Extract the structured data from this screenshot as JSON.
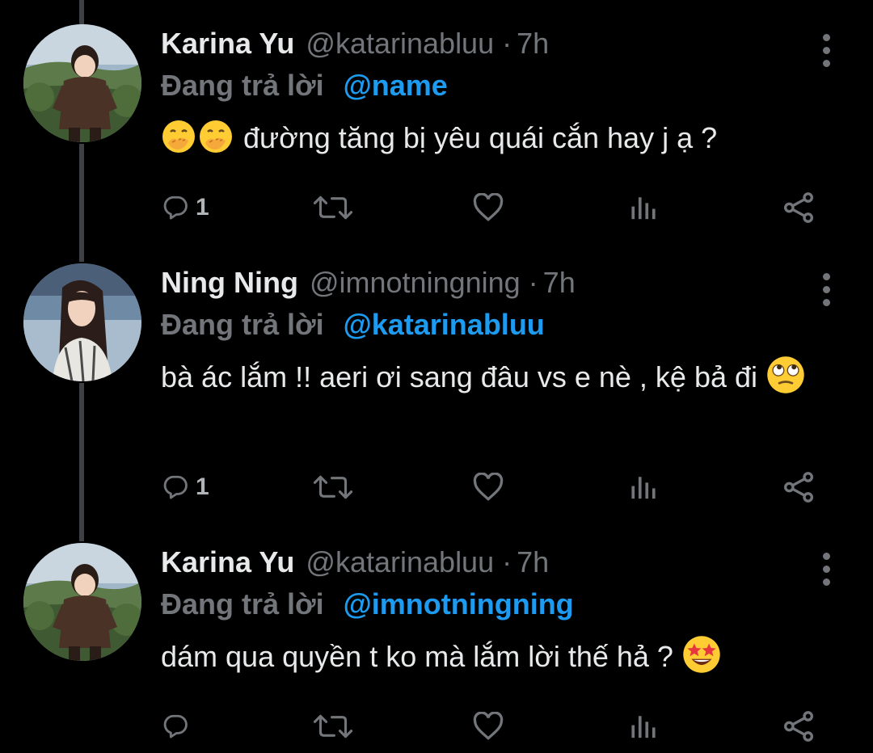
{
  "thread": [
    {
      "author_name": "Karina Yu",
      "handle": "@katarinabluu",
      "separator": "·",
      "time": "7h",
      "reply_prefix": "Đang trả lời",
      "reply_to": "@name",
      "text_before_emoji": "",
      "text_after_emoji": "đường tăng bị yêu quái cắn hay j ạ ?",
      "emoji": [
        "hand-over-mouth-emoji",
        "hand-over-mouth-emoji"
      ],
      "reply_count": "1",
      "avatar_icon": "child-portrait-avatar"
    },
    {
      "author_name": "Ning Ning",
      "handle": "@imnotningning",
      "separator": "·",
      "time": "7h",
      "reply_prefix": "Đang trả lời",
      "reply_to": "@katarinabluu",
      "text_before_emoji": "bà ác lắm !! aeri ơi sang đâu vs e nè , kệ bả đi",
      "text_after_emoji": "",
      "emoji": [
        "eye-roll-emoji"
      ],
      "reply_count": "1",
      "avatar_icon": "woman-portrait-avatar"
    },
    {
      "author_name": "Karina Yu",
      "handle": "@katarinabluu",
      "separator": "·",
      "time": "7h",
      "reply_prefix": "Đang trả lời",
      "reply_to": "@imnotningning",
      "text_before_emoji": "dám qua quyền t ko mà lắm lời thế hả ?",
      "text_after_emoji": "",
      "emoji": [
        "star-struck-emoji"
      ],
      "reply_count": "",
      "avatar_icon": "child-portrait-avatar"
    }
  ],
  "action_icons": [
    "reply-icon",
    "retweet-icon",
    "like-icon",
    "analytics-icon",
    "share-icon"
  ],
  "colors": {
    "background": "#000000",
    "text": "#e7e9ea",
    "muted": "#72767b",
    "mention": "#1d9bf0",
    "thread_line": "#3d4146"
  }
}
